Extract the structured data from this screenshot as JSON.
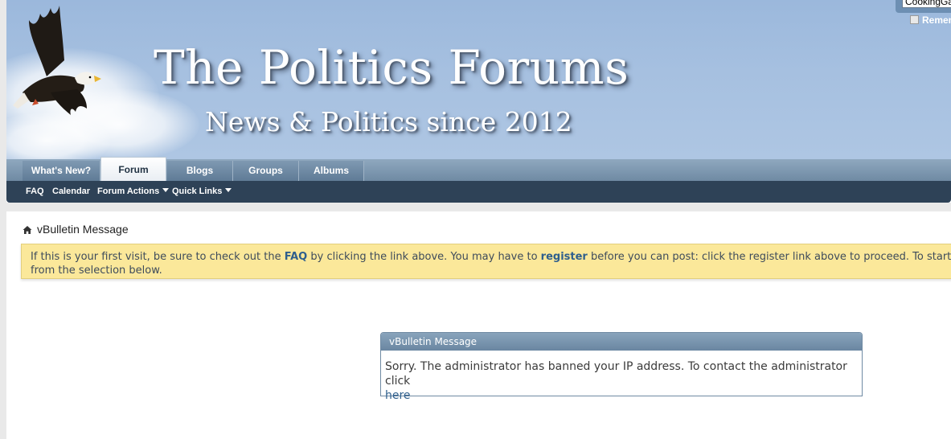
{
  "header": {
    "site_title": "The Politics Forums",
    "tagline": "News & Politics since 2012",
    "logo_icon": "eagle-icon",
    "login": {
      "username_value": "CookingGa",
      "remember_label": "Remem"
    }
  },
  "nav": {
    "tabs": [
      {
        "label": "What's New?",
        "active": false
      },
      {
        "label": "Forum",
        "active": true
      },
      {
        "label": "Blogs",
        "active": false
      },
      {
        "label": "Groups",
        "active": false
      },
      {
        "label": "Albums",
        "active": false
      }
    ],
    "subnav": [
      {
        "label": "FAQ",
        "dropdown": false
      },
      {
        "label": "Calendar",
        "dropdown": false
      },
      {
        "label": "Forum Actions",
        "dropdown": true
      },
      {
        "label": "Quick Links",
        "dropdown": true
      }
    ]
  },
  "breadcrumb": {
    "home_icon": "home-icon",
    "current": "vBulletin Message"
  },
  "notice": {
    "part1": "If this is your first visit, be sure to check out the ",
    "faq_link": "FAQ",
    "part2": " by clicking the link above. You may have to ",
    "register_link": "register",
    "part3": " before you can post: click the register link above to proceed. To start viewing",
    "line2": "from the selection below."
  },
  "message": {
    "title": "vBulletin Message",
    "body": "Sorry. The administrator has banned your IP address. To contact the administrator click",
    "link": "here"
  },
  "colors": {
    "banner": "#a6c0e0",
    "navbar": "#6f8aa3",
    "subnav": "#2e4257",
    "notice_bg": "#fbe89a",
    "link": "#2f5f8d"
  }
}
